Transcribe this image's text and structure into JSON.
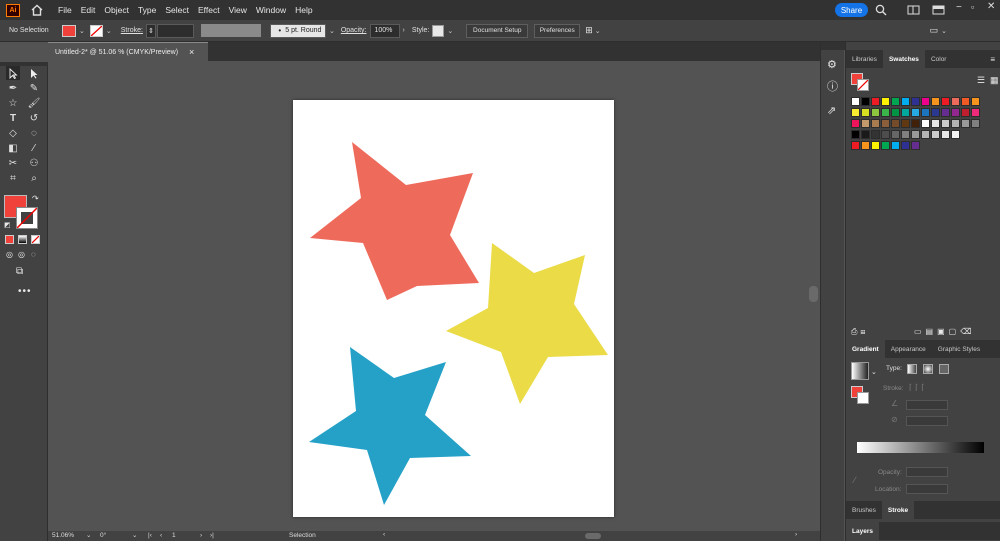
{
  "app": {
    "logo": "Ai"
  },
  "menu": {
    "items": [
      "File",
      "Edit",
      "Object",
      "Type",
      "Select",
      "Effect",
      "View",
      "Window",
      "Help"
    ],
    "share_label": "Share"
  },
  "control": {
    "selection_label": "No Selection",
    "stroke_label": "Stroke:",
    "brush_label": "5 pt. Round",
    "opacity_label": "Opacity:",
    "opacity_value": "100%",
    "style_label": "Style:",
    "document_setup": "Document Setup",
    "preferences": "Preferences"
  },
  "doc": {
    "tab_title": "Untitled-2* @ 51.06 % (CMYK/Preview)",
    "close": "×"
  },
  "status": {
    "zoom": "51.06%",
    "rotation": "0°",
    "artboard": "1",
    "tool": "Selection"
  },
  "panels": {
    "top_tabs": [
      "Libraries",
      "Swatches",
      "Color"
    ],
    "top_active": "Swatches",
    "gradient_tabs": [
      "Gradient",
      "Appearance",
      "Graphic Styles"
    ],
    "gradient_active": "Gradient",
    "type_label": "Type:",
    "stroke_label": "Stroke:",
    "opacity_label": "Opacity:",
    "location_label": "Location:",
    "brush_tabs": [
      "Brushes",
      "Stroke"
    ],
    "brush_active": "Stroke",
    "layers_tab": "Layers"
  },
  "colors": {
    "star_red": "#ee6b5c",
    "star_yellow": "#eadb47",
    "star_blue": "#25a1c8",
    "fill": "#f0423a",
    "accent": "#1473e6"
  },
  "stars": [
    {
      "name": "red-star",
      "color": "#ee6b5c"
    },
    {
      "name": "yellow-star",
      "color": "#eadb47"
    },
    {
      "name": "blue-star",
      "color": "#25a1c8"
    }
  ],
  "swatch_rows": [
    [
      "#ffffff",
      "#000000",
      "#ed1c24",
      "#fff200",
      "#00a651",
      "#00aeef",
      "#2e3192",
      "#ec008c",
      "#f7941d",
      "#ed1c24",
      "#ec6a5c",
      "#f15a24",
      "#f7941d"
    ],
    [
      "#f9ed32",
      "#d7df23",
      "#8dc63f",
      "#39b54a",
      "#009444",
      "#00a79d",
      "#27aae1",
      "#1c75bc",
      "#2b388f",
      "#662d91",
      "#92278f",
      "#be1e2d",
      "#ee2a7b"
    ],
    [
      "#ed145b",
      "#c49a6c",
      "#a97c50",
      "#8b5e3c",
      "#754c29",
      "#603913",
      "#42210b",
      "#ffffff",
      "#e6e6e6",
      "#cccccc",
      "#b3b3b3",
      "#999999",
      "#808080"
    ],
    [
      "#000000",
      "#1a1a1a",
      "#333333",
      "#4d4d4d",
      "#666666",
      "#808080",
      "#999999",
      "#b3b3b3",
      "#cccccc",
      "#e6e6e6",
      "#f2f2f2"
    ],
    [
      "#ed1c24",
      "#f7941d",
      "#fff200",
      "#00a651",
      "#00aeef",
      "#2e3192",
      "#662d91"
    ]
  ]
}
